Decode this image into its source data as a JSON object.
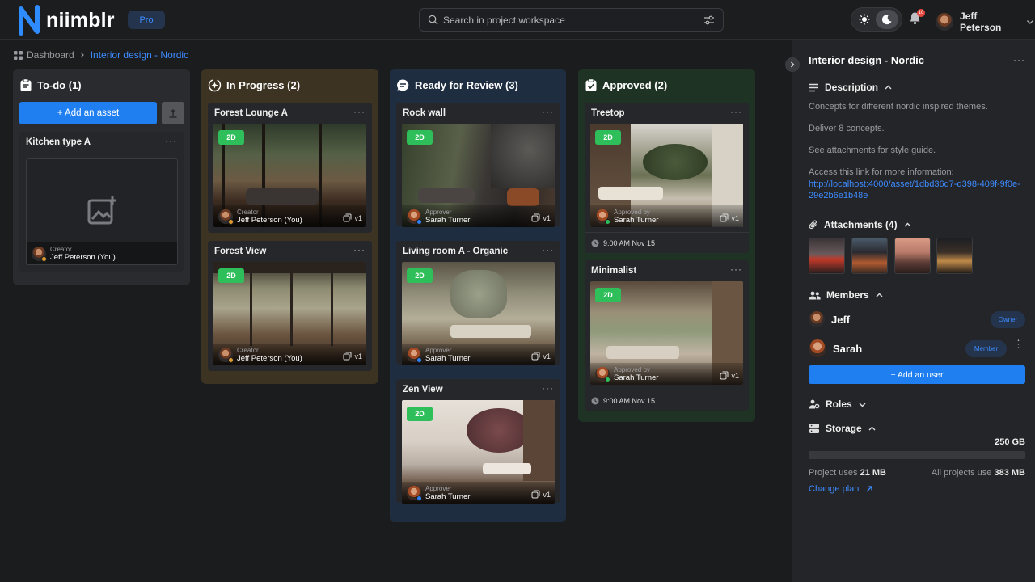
{
  "app": {
    "name": "niimblr",
    "plan": "Pro"
  },
  "search": {
    "placeholder": "Search in project workspace"
  },
  "header": {
    "notifications": "10",
    "user_name": "Jeff Peterson"
  },
  "breadcrumb": {
    "root": "Dashboard",
    "current": "Interior design - Nordic"
  },
  "columns": [
    {
      "title": "To-do (1)",
      "color": "#2a2b2e",
      "add_label": "+ Add an asset",
      "cards": [
        {
          "title": "Kitchen type A",
          "person_label": "Creator",
          "person_name": "Jeff Peterson (You)"
        }
      ]
    },
    {
      "title": "In Progress (2)",
      "color": "#3d3322",
      "cards": [
        {
          "title": "Forest Lounge A",
          "badge": "2D",
          "person_label": "Creator",
          "person_name": "Jeff Peterson (You)",
          "version": "v1"
        },
        {
          "title": "Forest View",
          "badge": "2D",
          "person_label": "Creator",
          "person_name": "Jeff Peterson (You)",
          "version": "v1"
        }
      ]
    },
    {
      "title": "Ready for Review (3)",
      "color": "#1f2d40",
      "cards": [
        {
          "title": "Rock wall",
          "badge": "2D",
          "person_label": "Approver",
          "person_name": "Sarah Turner",
          "version": "v1"
        },
        {
          "title": "Living room A - Organic",
          "badge": "2D",
          "person_label": "Approver",
          "person_name": "Sarah Turner",
          "version": "v1"
        },
        {
          "title": "Zen View",
          "badge": "2D",
          "person_label": "Approver",
          "person_name": "Sarah Turner",
          "version": "v1"
        }
      ]
    },
    {
      "title": "Approved (2)",
      "color": "#1f3324",
      "cards": [
        {
          "title": "Treetop",
          "badge": "2D",
          "person_label": "Approved by",
          "person_name": "Sarah Turner",
          "version": "v1",
          "time": "9:00 AM Nov 15"
        },
        {
          "title": "Minimalist",
          "badge": "2D",
          "person_label": "Approved by",
          "person_name": "Sarah Turner",
          "version": "v1",
          "time": "9:00 AM Nov 15"
        }
      ]
    }
  ],
  "panel": {
    "title": "Interior design - Nordic",
    "description_heading": "Description",
    "description": [
      "Concepts for different nordic inspired themes.",
      "Deliver 8 concepts.",
      "See attachments for style guide.",
      "Access this link for more information:"
    ],
    "link": "http://localhost:4000/asset/1dbd36d7-d398-409f-9f0e-29e2b6e1b48e",
    "attachments_heading": "Attachments (4)",
    "members_heading": "Members",
    "members": [
      {
        "name": "Jeff",
        "role": "Owner"
      },
      {
        "name": "Sarah",
        "role": "Member"
      }
    ],
    "add_user_label": "+  Add an user",
    "roles_heading": "Roles",
    "storage_heading": "Storage",
    "storage_total": "250 GB",
    "storage_fraction": 0.0015,
    "project_uses_label": "Project uses",
    "project_uses_value": "21 MB",
    "all_projects_label": "All projects use",
    "all_projects_value": "383 MB",
    "change_plan": "Change plan"
  },
  "colors": {
    "accent": "#1f7ff0",
    "badge": "#2fbf5a",
    "notification": "#e5483f",
    "storage": "#e07b2c"
  }
}
